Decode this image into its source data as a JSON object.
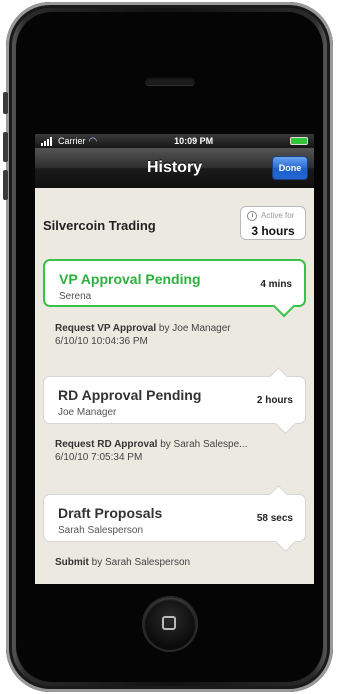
{
  "status_bar": {
    "carrier": "Carrier",
    "time": "10:09 PM"
  },
  "nav": {
    "title": "History",
    "done_label": "Done"
  },
  "company": {
    "name": "Silvercoin Trading",
    "active_label": "Active for",
    "active_value": "3 hours"
  },
  "stages": [
    {
      "title": "VP Approval Pending",
      "person": "Serena",
      "duration": "4 mins"
    },
    {
      "title": "RD Approval Pending",
      "person": "Joe Manager",
      "duration": "2 hours"
    },
    {
      "title": "Draft Proposals",
      "person": "Sarah Salesperson",
      "duration": "58 secs"
    }
  ],
  "events": [
    {
      "action": "Request VP Approval",
      "by": "by Joe Manager",
      "timestamp": "6/10/10 10:04:36 PM"
    },
    {
      "action": "Request RD Approval",
      "by": "by Sarah Salespe...",
      "timestamp": "6/10/10 7:05:34 PM"
    },
    {
      "action": "Submit",
      "by": "by Sarah Salesperson",
      "timestamp": ""
    }
  ],
  "colors": {
    "current_stage": "#39c24a",
    "done_button": "#2a6bd6",
    "screen_bg": "#ece9e1"
  }
}
